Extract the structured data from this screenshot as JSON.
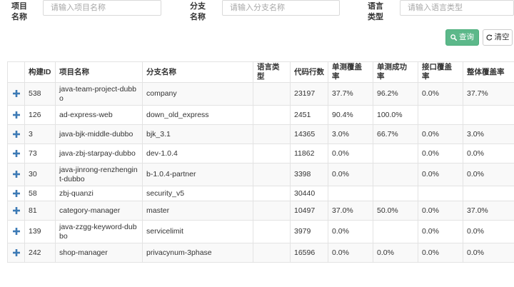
{
  "filters": {
    "project": {
      "label": "项目名称",
      "placeholder": "请输入项目名称"
    },
    "branch": {
      "label": "分支名称",
      "placeholder": "请输入分支名称"
    },
    "language": {
      "label": "语言类型",
      "placeholder": "请输入语言类型"
    }
  },
  "buttons": {
    "search": "查询",
    "clear": "清空"
  },
  "colors": {
    "search_button": "#5cb88a",
    "expand_icon": "#3c7ab5",
    "row_stripe": "#f9f9f9",
    "border": "#e3e3e3"
  },
  "icons": {
    "search": "search-icon",
    "clear": "refresh-icon",
    "expand": "plus-icon"
  },
  "table": {
    "columns": [
      "",
      "构建ID",
      "项目名称",
      "分支名称",
      "语言类型",
      "代码行数",
      "单测覆盖率",
      "单测成功率",
      "接口覆盖率",
      "整体覆盖率"
    ],
    "rows": [
      [
        "538",
        "java-team-project-dubbo",
        "company",
        "",
        "23197",
        "37.7%",
        "96.2%",
        "0.0%",
        "37.7%"
      ],
      [
        "126",
        "ad-express-web",
        "down_old_express",
        "",
        "2451",
        "90.4%",
        "100.0%",
        "",
        ""
      ],
      [
        "3",
        "java-bjk-middle-dubbo",
        "bjk_3.1",
        "",
        "14365",
        "3.0%",
        "66.7%",
        "0.0%",
        "3.0%"
      ],
      [
        "73",
        "java-zbj-starpay-dubbo",
        "dev-1.0.4",
        "",
        "11862",
        "0.0%",
        "",
        "0.0%",
        "0.0%"
      ],
      [
        "30",
        "java-jinrong-renzhengint-dubbo",
        "b-1.0.4-partner",
        "",
        "3398",
        "0.0%",
        "",
        "0.0%",
        "0.0%"
      ],
      [
        "58",
        "zbj-quanzi",
        "security_v5",
        "",
        "30440",
        "",
        "",
        "",
        ""
      ],
      [
        "81",
        "category-manager",
        "master",
        "",
        "10497",
        "37.0%",
        "50.0%",
        "0.0%",
        "37.0%"
      ],
      [
        "139",
        "java-zzgg-keyword-dubbo",
        "servicelimit",
        "",
        "3979",
        "0.0%",
        "",
        "0.0%",
        "0.0%"
      ],
      [
        "242",
        "shop-manager",
        "privacynum-3phase",
        "",
        "16596",
        "0.0%",
        "0.0%",
        "0.0%",
        "0.0%"
      ]
    ]
  }
}
